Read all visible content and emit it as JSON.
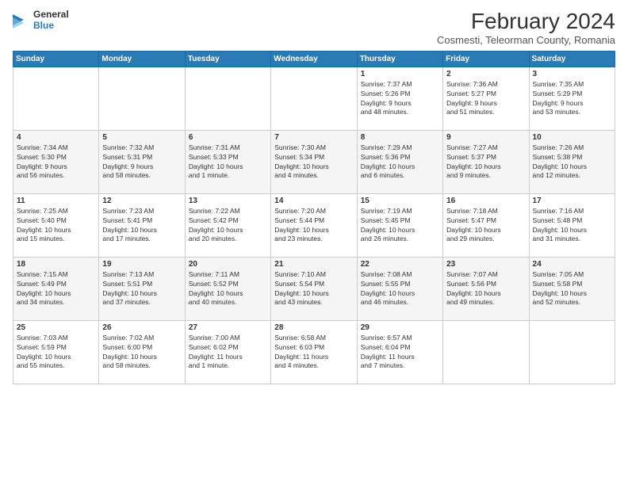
{
  "logo": {
    "line1": "General",
    "line2": "Blue"
  },
  "title": "February 2024",
  "subtitle": "Cosmesti, Teleorman County, Romania",
  "days_header": [
    "Sunday",
    "Monday",
    "Tuesday",
    "Wednesday",
    "Thursday",
    "Friday",
    "Saturday"
  ],
  "weeks": [
    [
      {
        "day": "",
        "info": ""
      },
      {
        "day": "",
        "info": ""
      },
      {
        "day": "",
        "info": ""
      },
      {
        "day": "",
        "info": ""
      },
      {
        "day": "1",
        "info": "Sunrise: 7:37 AM\nSunset: 5:26 PM\nDaylight: 9 hours\nand 48 minutes."
      },
      {
        "day": "2",
        "info": "Sunrise: 7:36 AM\nSunset: 5:27 PM\nDaylight: 9 hours\nand 51 minutes."
      },
      {
        "day": "3",
        "info": "Sunrise: 7:35 AM\nSunset: 5:29 PM\nDaylight: 9 hours\nand 53 minutes."
      }
    ],
    [
      {
        "day": "4",
        "info": "Sunrise: 7:34 AM\nSunset: 5:30 PM\nDaylight: 9 hours\nand 56 minutes."
      },
      {
        "day": "5",
        "info": "Sunrise: 7:32 AM\nSunset: 5:31 PM\nDaylight: 9 hours\nand 58 minutes."
      },
      {
        "day": "6",
        "info": "Sunrise: 7:31 AM\nSunset: 5:33 PM\nDaylight: 10 hours\nand 1 minute."
      },
      {
        "day": "7",
        "info": "Sunrise: 7:30 AM\nSunset: 5:34 PM\nDaylight: 10 hours\nand 4 minutes."
      },
      {
        "day": "8",
        "info": "Sunrise: 7:29 AM\nSunset: 5:36 PM\nDaylight: 10 hours\nand 6 minutes."
      },
      {
        "day": "9",
        "info": "Sunrise: 7:27 AM\nSunset: 5:37 PM\nDaylight: 10 hours\nand 9 minutes."
      },
      {
        "day": "10",
        "info": "Sunrise: 7:26 AM\nSunset: 5:38 PM\nDaylight: 10 hours\nand 12 minutes."
      }
    ],
    [
      {
        "day": "11",
        "info": "Sunrise: 7:25 AM\nSunset: 5:40 PM\nDaylight: 10 hours\nand 15 minutes."
      },
      {
        "day": "12",
        "info": "Sunrise: 7:23 AM\nSunset: 5:41 PM\nDaylight: 10 hours\nand 17 minutes."
      },
      {
        "day": "13",
        "info": "Sunrise: 7:22 AM\nSunset: 5:42 PM\nDaylight: 10 hours\nand 20 minutes."
      },
      {
        "day": "14",
        "info": "Sunrise: 7:20 AM\nSunset: 5:44 PM\nDaylight: 10 hours\nand 23 minutes."
      },
      {
        "day": "15",
        "info": "Sunrise: 7:19 AM\nSunset: 5:45 PM\nDaylight: 10 hours\nand 26 minutes."
      },
      {
        "day": "16",
        "info": "Sunrise: 7:18 AM\nSunset: 5:47 PM\nDaylight: 10 hours\nand 29 minutes."
      },
      {
        "day": "17",
        "info": "Sunrise: 7:16 AM\nSunset: 5:48 PM\nDaylight: 10 hours\nand 31 minutes."
      }
    ],
    [
      {
        "day": "18",
        "info": "Sunrise: 7:15 AM\nSunset: 5:49 PM\nDaylight: 10 hours\nand 34 minutes."
      },
      {
        "day": "19",
        "info": "Sunrise: 7:13 AM\nSunset: 5:51 PM\nDaylight: 10 hours\nand 37 minutes."
      },
      {
        "day": "20",
        "info": "Sunrise: 7:11 AM\nSunset: 5:52 PM\nDaylight: 10 hours\nand 40 minutes."
      },
      {
        "day": "21",
        "info": "Sunrise: 7:10 AM\nSunset: 5:54 PM\nDaylight: 10 hours\nand 43 minutes."
      },
      {
        "day": "22",
        "info": "Sunrise: 7:08 AM\nSunset: 5:55 PM\nDaylight: 10 hours\nand 46 minutes."
      },
      {
        "day": "23",
        "info": "Sunrise: 7:07 AM\nSunset: 5:56 PM\nDaylight: 10 hours\nand 49 minutes."
      },
      {
        "day": "24",
        "info": "Sunrise: 7:05 AM\nSunset: 5:58 PM\nDaylight: 10 hours\nand 52 minutes."
      }
    ],
    [
      {
        "day": "25",
        "info": "Sunrise: 7:03 AM\nSunset: 5:59 PM\nDaylight: 10 hours\nand 55 minutes."
      },
      {
        "day": "26",
        "info": "Sunrise: 7:02 AM\nSunset: 6:00 PM\nDaylight: 10 hours\nand 58 minutes."
      },
      {
        "day": "27",
        "info": "Sunrise: 7:00 AM\nSunset: 6:02 PM\nDaylight: 11 hours\nand 1 minute."
      },
      {
        "day": "28",
        "info": "Sunrise: 6:58 AM\nSunset: 6:03 PM\nDaylight: 11 hours\nand 4 minutes."
      },
      {
        "day": "29",
        "info": "Sunrise: 6:57 AM\nSunset: 6:04 PM\nDaylight: 11 hours\nand 7 minutes."
      },
      {
        "day": "",
        "info": ""
      },
      {
        "day": "",
        "info": ""
      }
    ]
  ]
}
